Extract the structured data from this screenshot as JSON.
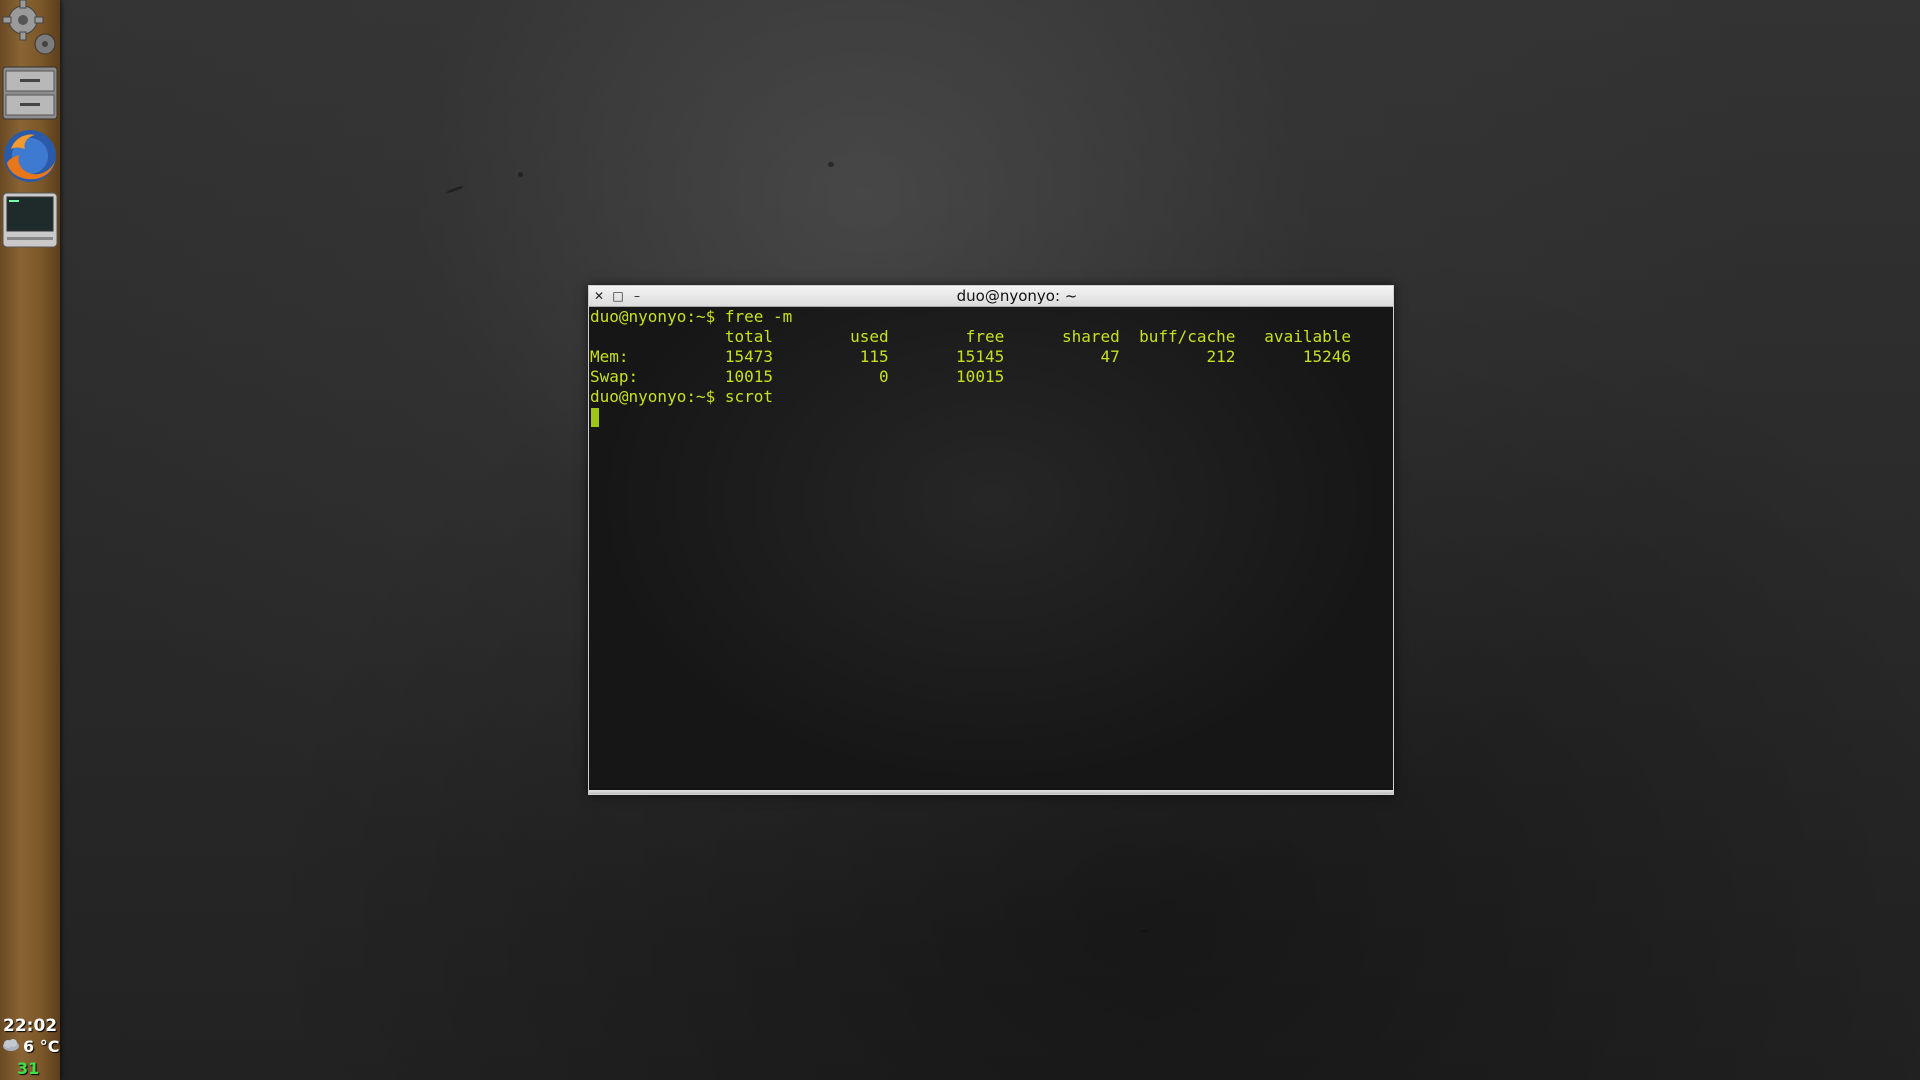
{
  "dock": {
    "items": [
      {
        "name": "settings",
        "icon": "gear-icon"
      },
      {
        "name": "file-cabinet",
        "icon": "drawer-icon"
      },
      {
        "name": "firefox",
        "icon": "firefox-icon"
      },
      {
        "name": "terminal",
        "icon": "monitor-icon"
      }
    ],
    "clock": "22:02",
    "weather_temp": "6 °C",
    "weather_icon": "cloud-icon",
    "number": "31",
    "number_color": "#3ee04a"
  },
  "terminal": {
    "title": "duo@nyonyo: ~",
    "buttons": {
      "close": "✕",
      "maximize": "□",
      "minimize": "–"
    },
    "lines": [
      "duo@nyonyo:~$ free -m",
      "              total        used        free      shared  buff/cache   available",
      "Mem:          15473         115       15145          47         212       15246",
      "Swap:         10015           0       10015",
      "duo@nyonyo:~$ scrot"
    ],
    "text_color": "#c8e01c",
    "cursor_color": "#9ec61a"
  }
}
